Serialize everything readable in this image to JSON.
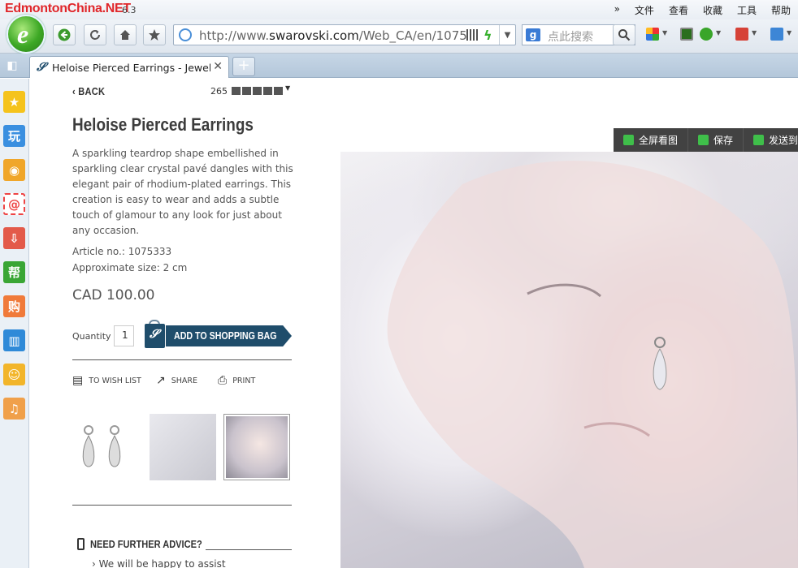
{
  "watermark": "EdmontonChina.NET",
  "app": {
    "version": "6.3"
  },
  "menu": {
    "items": [
      "文件",
      "查看",
      "收藏",
      "工具",
      "帮助"
    ]
  },
  "nav": {
    "url_prefix": "http://www.",
    "url_domain": "swarovski.com",
    "url_path": "/Web_CA/en/1075",
    "search_placeholder": "点此搜索",
    "search_engine": "g"
  },
  "tab": {
    "title": "Heloise Pierced Earrings - Jewelry",
    "new_tab": "+"
  },
  "sidebar": {
    "items": [
      "收藏",
      "玩",
      "微博",
      "邮件",
      "下载",
      "帮",
      "购",
      "阅读",
      "游戏",
      "音乐"
    ],
    "labels": [
      "★",
      "玩",
      "◉",
      "@",
      "⇩",
      "帮",
      "购",
      "▥",
      "☺",
      "♫"
    ]
  },
  "product": {
    "back_label": "BACK",
    "pager_count": "265",
    "title": "Heloise Pierced Earrings",
    "description": "A sparkling teardrop shape embellished in sparkling clear crystal pavé dangles with this elegant pair of rhodium-plated earrings. This creation is easy to wear and adds a subtle touch of glamour to any look for just about any occasion.",
    "article": "Article no.: 1075333",
    "size": "Approximate size: 2 cm",
    "price": "CAD 100.00",
    "quantity_label": "Quantity",
    "quantity_value": "1",
    "add_to_bag": "ADD TO SHOPPING BAG",
    "actions": {
      "wishlist": "TO WISH LIST",
      "share": "SHARE",
      "print": "PRINT"
    },
    "advice_title": "NEED FURTHER ADVICE?",
    "advice_text": "We will be happy to assist"
  },
  "image_toolbar": {
    "fullscreen": "全屏看图",
    "save": "保存",
    "send": "发送到"
  }
}
